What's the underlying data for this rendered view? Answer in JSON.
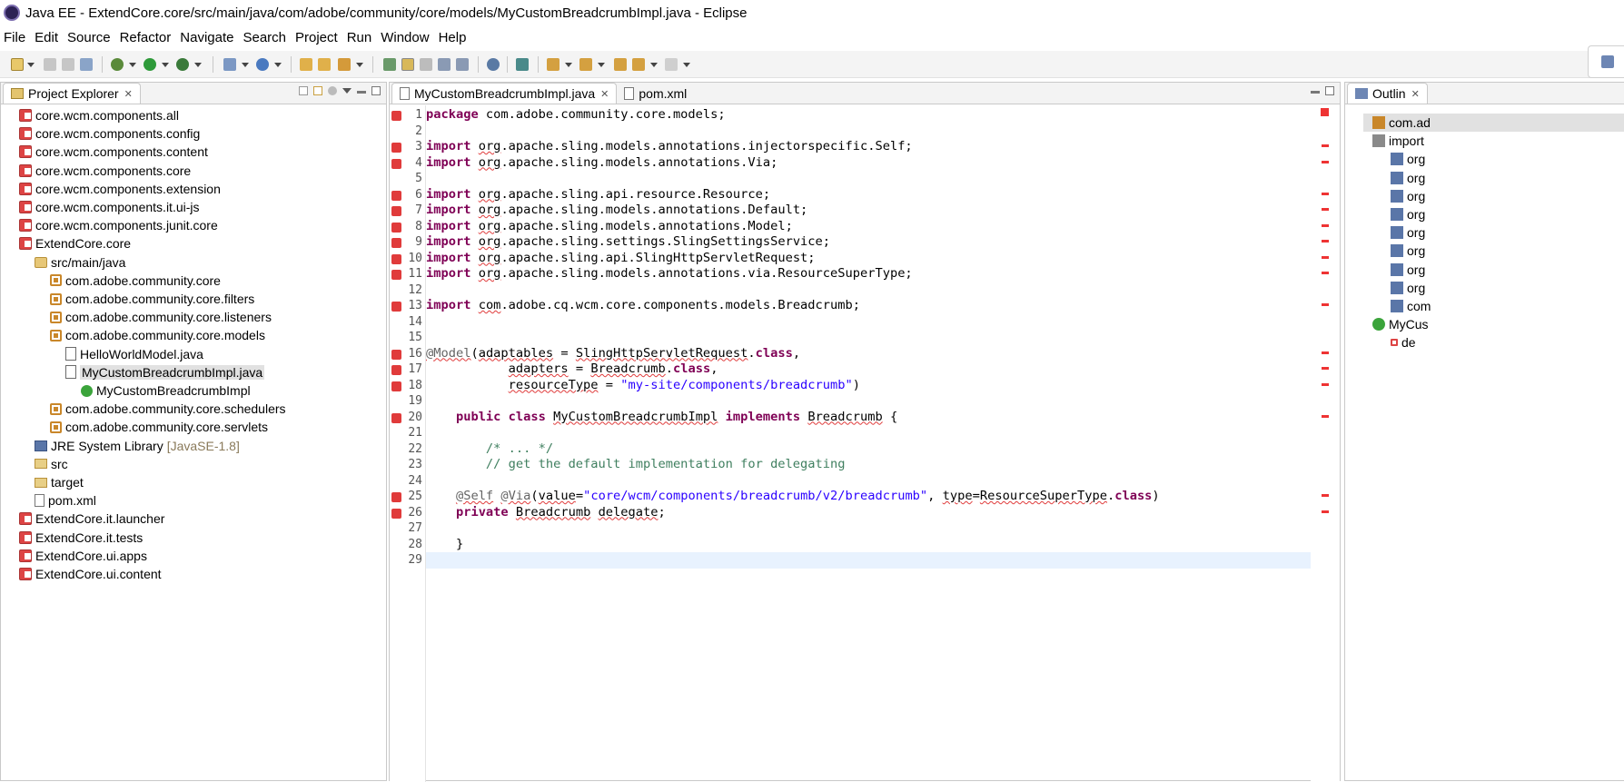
{
  "window": {
    "title": "Java EE - ExtendCore.core/src/main/java/com/adobe/community/core/models/MyCustomBreadcrumbImpl.java - Eclipse"
  },
  "menu": [
    "File",
    "Edit",
    "Source",
    "Refactor",
    "Navigate",
    "Search",
    "Project",
    "Run",
    "Window",
    "Help"
  ],
  "explorer": {
    "tab": "Project Explorer",
    "items": [
      {
        "label": "core.wcm.components.all",
        "icon": "project-icon"
      },
      {
        "label": "core.wcm.components.config",
        "icon": "project-icon"
      },
      {
        "label": "core.wcm.components.content",
        "icon": "project-icon"
      },
      {
        "label": "core.wcm.components.core",
        "icon": "project-icon"
      },
      {
        "label": "core.wcm.components.extension",
        "icon": "project-icon"
      },
      {
        "label": "core.wcm.components.it.ui-js",
        "icon": "project-icon"
      },
      {
        "label": "core.wcm.components.junit.core",
        "icon": "project-icon"
      },
      {
        "label": "ExtendCore.core",
        "icon": "project-icon"
      },
      {
        "label": "src/main/java",
        "icon": "source-folder-icon"
      },
      {
        "label": "com.adobe.community.core",
        "icon": "package-icon"
      },
      {
        "label": "com.adobe.community.core.filters",
        "icon": "package-icon"
      },
      {
        "label": "com.adobe.community.core.listeners",
        "icon": "package-icon"
      },
      {
        "label": "com.adobe.community.core.models",
        "icon": "package-icon"
      },
      {
        "label": "HelloWorldModel.java",
        "icon": "java-file-icon"
      },
      {
        "label": "MyCustomBreadcrumbImpl.java",
        "icon": "java-file-icon"
      },
      {
        "label": "MyCustomBreadcrumbImpl",
        "icon": "class-icon"
      },
      {
        "label": "com.adobe.community.core.schedulers",
        "icon": "package-icon"
      },
      {
        "label": "com.adobe.community.core.servlets",
        "icon": "package-icon"
      },
      {
        "label": "JRE System Library",
        "extra": "[JavaSE-1.8]",
        "icon": "library-icon"
      },
      {
        "label": "src",
        "icon": "folder-icon"
      },
      {
        "label": "target",
        "icon": "folder-icon"
      },
      {
        "label": "pom.xml",
        "icon": "xml-file-icon"
      },
      {
        "label": "ExtendCore.it.launcher",
        "icon": "project-icon"
      },
      {
        "label": "ExtendCore.it.tests",
        "icon": "project-icon"
      },
      {
        "label": "ExtendCore.ui.apps",
        "icon": "project-icon"
      },
      {
        "label": "ExtendCore.ui.content",
        "icon": "project-icon"
      }
    ]
  },
  "editor": {
    "tabs": [
      "MyCustomBreadcrumbImpl.java",
      "pom.xml"
    ],
    "line_numbers": [
      "1",
      "2",
      "3",
      "4",
      "5",
      "6",
      "7",
      "8",
      "9",
      "10",
      "11",
      "12",
      "13",
      "14",
      "15",
      "16",
      "17",
      "18",
      "19",
      "20",
      "21",
      "22",
      "23",
      "24",
      "25",
      "26",
      "27",
      "28",
      "29"
    ],
    "code": {
      "l1_kw": "package",
      "l1_rest": " com.adobe.community.core.models;",
      "import": "import",
      "l3_pkg": "org",
      "l3_rest": ".apache.sling.models.annotations.injectorspecific.Self;",
      "l4_pkg": "org",
      "l4_rest": ".apache.sling.models.annotations.Via;",
      "l6_pkg": "org",
      "l6_rest": ".apache.sling.api.resource.Resource;",
      "l7_pkg": "org",
      "l7_rest": ".apache.sling.models.annotations.Default;",
      "l8_pkg": "org",
      "l8_rest": ".apache.sling.models.annotations.Model;",
      "l9_pkg": "org",
      "l9_rest": ".apache.sling.settings.SlingSettingsService;",
      "l10_pkg": "org",
      "l10_rest": ".apache.sling.api.SlingHttpServletRequest;",
      "l11_pkg": "org",
      "l11_rest": ".apache.sling.models.annotations.via.ResourceSuperType;",
      "l13_pkg": "com",
      "l13_rest": ".adobe.cq.wcm.core.components.models.Breadcrumb;",
      "l16_at": "@Model",
      "l16_a": "(",
      "l16_b": "adaptables",
      "l16_c": " = ",
      "l16_d": "SlingHttpServletRequest",
      "l16_e": ".",
      "l16_f": "class",
      "l16_g": ",",
      "l17_pre": "           ",
      "l17_b": "adapters",
      "l17_c": " = ",
      "l17_d": "Breadcrumb",
      "l17_e": ".",
      "l17_f": "class",
      "l17_g": ",",
      "l18_pre": "           ",
      "l18_b": "resourceType",
      "l18_c": " = ",
      "l18_str": "\"my-site/components/breadcrumb\"",
      "l18_g": ")",
      "l20_pre": "    ",
      "l20_k1": "public",
      "l20_sp": " ",
      "l20_k2": "class",
      "l20_sp2": " ",
      "l20_name": "MyCustomBreadcrumbImpl",
      "l20_sp3": " ",
      "l20_k3": "implements",
      "l20_sp4": " ",
      "l20_iface": "Breadcrumb",
      "l20_end": " {",
      "l22": "        /* ... */",
      "l23": "        // get the default implementation for delegating",
      "l25_pre": "    ",
      "l25_a1": "@Self",
      "l25_sp": " ",
      "l25_a2": "@Via",
      "l25_p": "(",
      "l25_v": "value",
      "l25_eq": "=",
      "l25_str": "\"core/wcm/components/breadcrumb/v2/breadcrumb\"",
      "l25_cm": ", ",
      "l25_t": "type",
      "l25_eq2": "=",
      "l25_rst": "ResourceSuperType",
      "l25_dot": ".",
      "l25_cls": "class",
      "l25_end": ")",
      "l26_pre": "    ",
      "l26_kw": "private",
      "l26_sp": " ",
      "l26_type": "Breadcrumb",
      "l26_sp2": " ",
      "l26_var": "delegate",
      "l26_end": ";",
      "l28": "    }"
    }
  },
  "outline": {
    "tab": "Outlin",
    "items": [
      "com.ad",
      "import",
      "org",
      "org",
      "org",
      "org",
      "org",
      "org",
      "org",
      "org",
      "com",
      "MyCus",
      "de"
    ]
  },
  "colors": {
    "keyword": "#7f0055",
    "string": "#2a00ff",
    "comment": "#3f7f5f",
    "error": "#e03b3b",
    "current_line": "#e8f2fe"
  }
}
